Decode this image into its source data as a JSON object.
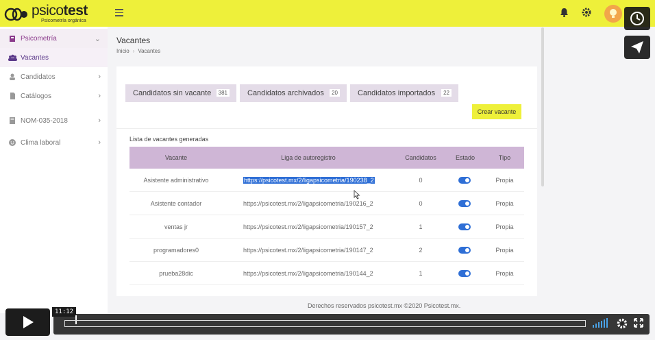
{
  "brand": {
    "name_light": "psico",
    "name_bold": "test",
    "tagline": "Psicometría orgánica"
  },
  "colors": {
    "accent": "#eef03a",
    "primary": "#8b3b8c",
    "table_header": "#cfb6d6",
    "toggle": "#2f6fd6"
  },
  "sidebar": {
    "items": [
      {
        "label": "Psicometría",
        "icon": "clipboard-icon"
      },
      {
        "label": "Vacantes",
        "icon": "users-icon"
      },
      {
        "label": "Candidatos",
        "icon": "user-icon"
      },
      {
        "label": "Catálogos",
        "icon": "file-icon"
      },
      {
        "label": "NOM-035-2018",
        "icon": "book-icon"
      },
      {
        "label": "Clima laboral",
        "icon": "smile-icon"
      }
    ]
  },
  "page": {
    "title": "Vacantes",
    "breadcrumb": [
      "Inicio",
      "Vacantes"
    ]
  },
  "tabs": [
    {
      "label": "Candidatos sin vacante",
      "count": "381"
    },
    {
      "label": "Candidatos archivados",
      "count": "20"
    },
    {
      "label": "Candidatos importados",
      "count": "22"
    }
  ],
  "create_button": "Crear vacante",
  "list_title": "Lista de vacantes generadas",
  "table": {
    "headers": [
      "Vacante",
      "Liga de autoregistro",
      "Candidatos",
      "Estado",
      "Tipo"
    ],
    "rows": [
      {
        "vacante": "Asistente administrativo",
        "liga": "https://psicotest.mx/2/ligapsicometria/190238_2",
        "candidatos": "0",
        "estado": true,
        "tipo": "Propia"
      },
      {
        "vacante": "Asistente contador",
        "liga": "https://psicotest.mx/2/ligapsicometria/190216_2",
        "candidatos": "0",
        "estado": true,
        "tipo": "Propia"
      },
      {
        "vacante": "ventas jr",
        "liga": "https://psicotest.mx/2/ligapsicometria/190157_2",
        "candidatos": "1",
        "estado": true,
        "tipo": "Propia"
      },
      {
        "vacante": "programadores0",
        "liga": "https://psicotest.mx/2/ligapsicometria/190147_2",
        "candidatos": "2",
        "estado": true,
        "tipo": "Propia"
      },
      {
        "vacante": "prueba28dic",
        "liga": "https://psicotest.mx/2/ligapsicometria/190144_2",
        "candidatos": "1",
        "estado": true,
        "tipo": "Propia"
      }
    ]
  },
  "footer": "Derechos reservados psicotest.mx ©2020 Psicotest.mx.",
  "video": {
    "time": "11:12"
  }
}
